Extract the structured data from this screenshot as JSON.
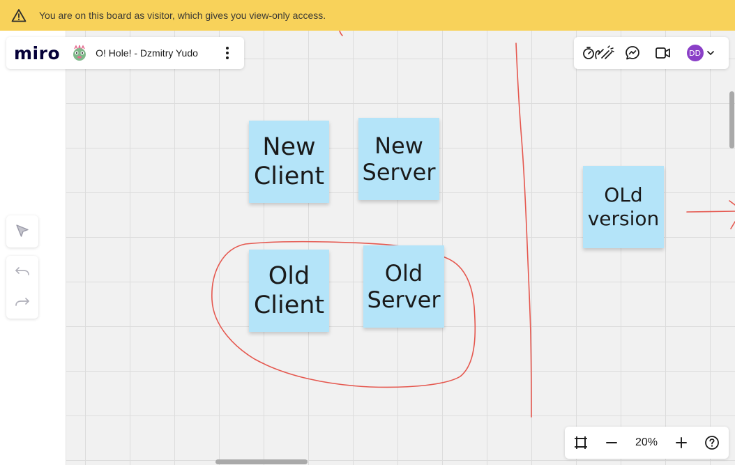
{
  "banner": {
    "text": "You are on this board as visitor, which gives you view-only access.",
    "icon": "warning-triangle-icon",
    "color": "#f8d25a"
  },
  "board": {
    "logo": "miro",
    "title": "O! Hole! - Dzmitry Yudo",
    "menu_icon": "more-vertical-icon"
  },
  "collab": {
    "icons": [
      "timer-reactions-icon",
      "chat-icon",
      "video-icon"
    ],
    "user_initials": "DD",
    "user_color": "#8a3fc7"
  },
  "tools": {
    "select_icon": "select-cursor-icon",
    "undo_icon": "undo-icon",
    "redo_icon": "redo-icon"
  },
  "stickies": [
    {
      "id": "new-client",
      "text": "New\nClient"
    },
    {
      "id": "new-server",
      "text": "New\nServer"
    },
    {
      "id": "old-client",
      "text": "Old\nClient"
    },
    {
      "id": "old-server",
      "text": "Old\nServer"
    },
    {
      "id": "old-version",
      "text": "OLd\nversion"
    }
  ],
  "sticky_color": "#b4e4f9",
  "ink_color": "#e5574e",
  "zoom": {
    "level": "20%",
    "fit_icon": "fit-to-screen-icon",
    "minus_icon": "zoom-out-icon",
    "plus_icon": "zoom-in-icon",
    "help_icon": "help-icon"
  }
}
